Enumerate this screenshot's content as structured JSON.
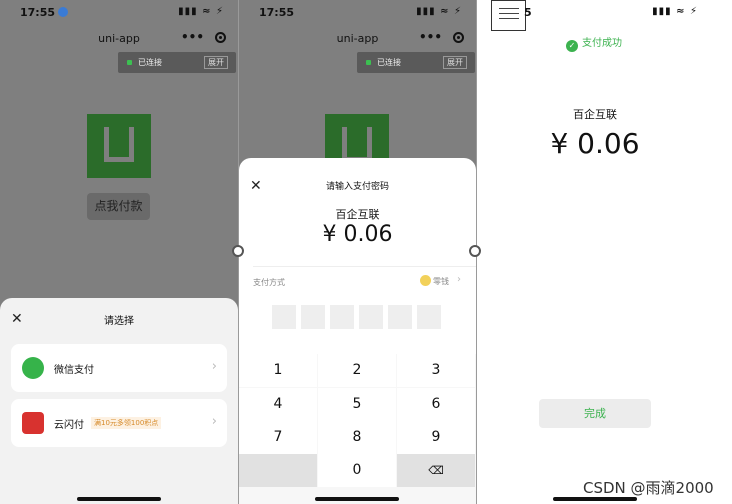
{
  "status": {
    "time": "17:55",
    "icons": "▮▮▮ ≈ ⚡"
  },
  "panel1": {
    "nav_title": "uni-app",
    "nav_more": "•••",
    "conn_text": "已连接",
    "conn_expand": "展开",
    "pay_button": "点我付款",
    "sheet_title": "请选择",
    "options": [
      {
        "label": "微信支付",
        "tag": "",
        "icon": "wechat-pay-icon",
        "color": "#36b34a"
      },
      {
        "label": "云闪付",
        "tag": "满10元多领100积点",
        "icon": "unionpay-icon",
        "color": "#d8322f"
      }
    ]
  },
  "panel2": {
    "nav_title": "uni-app",
    "nav_more": "•••",
    "conn_text": "已连接",
    "conn_expand": "展开",
    "sheet_title": "请输入支付密码",
    "merchant": "百企互联",
    "amount": "¥ 0.06",
    "method_label": "支付方式",
    "method_value": "零钱",
    "keys": [
      "1",
      "2",
      "3",
      "4",
      "5",
      "6",
      "7",
      "8",
      "9",
      "",
      "0",
      "⌫"
    ]
  },
  "panel3": {
    "success_text": "支付成功",
    "merchant": "百企互联",
    "amount": "¥ 0.06",
    "done_label": "完成",
    "watermark": "CSDN @雨滴2000"
  },
  "colors": {
    "accent": "#3cb24f",
    "overlay": "#7f7f7f",
    "logo": "#2b6c2a"
  }
}
